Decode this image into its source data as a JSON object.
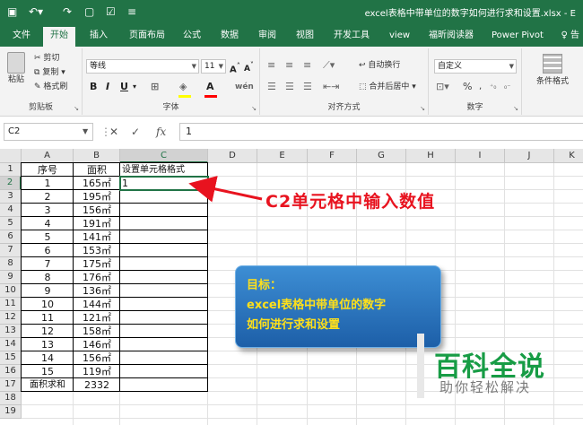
{
  "titlebar": {
    "document_title": "excel表格中带单位的数字如何进行求和设置.xlsx  -  E"
  },
  "ribbon_tabs": [
    "文件",
    "开始",
    "插入",
    "页面布局",
    "公式",
    "数据",
    "审阅",
    "视图",
    "开发工具",
    "view",
    "福昕阅读器",
    "Power Pivot"
  ],
  "active_tab": "开始",
  "ribbon": {
    "clipboard": {
      "paste": "粘贴",
      "cut": "剪切",
      "copy": "复制",
      "format_painter": "格式刷",
      "label": "剪贴板"
    },
    "font": {
      "name": "等线",
      "size": "11",
      "label": "字体"
    },
    "alignment": {
      "wrap": "自动换行",
      "merge": "合并后居中",
      "label": "对齐方式"
    },
    "number": {
      "format": "自定义",
      "label": "数字"
    },
    "styles": {
      "conditional": "条件格式"
    }
  },
  "formula_bar": {
    "name_box": "C2",
    "formula": "1"
  },
  "columns": [
    "A",
    "B",
    "C",
    "D",
    "E",
    "F",
    "G",
    "H",
    "I",
    "J",
    "K"
  ],
  "selected_column": "C",
  "rows": [
    "1",
    "2",
    "3",
    "4",
    "5",
    "6",
    "7",
    "8",
    "9",
    "10",
    "11",
    "12",
    "13",
    "14",
    "15",
    "16",
    "17",
    "18",
    "19"
  ],
  "selected_row": "2",
  "table": {
    "header": {
      "a": "序号",
      "b": "面积",
      "c": "设置单元格格式"
    },
    "data": [
      {
        "a": "1",
        "b": "165㎡",
        "c": "1"
      },
      {
        "a": "2",
        "b": "195㎡",
        "c": ""
      },
      {
        "a": "3",
        "b": "156㎡",
        "c": ""
      },
      {
        "a": "4",
        "b": "191㎡",
        "c": ""
      },
      {
        "a": "5",
        "b": "141㎡",
        "c": ""
      },
      {
        "a": "6",
        "b": "153㎡",
        "c": ""
      },
      {
        "a": "7",
        "b": "175㎡",
        "c": ""
      },
      {
        "a": "8",
        "b": "176㎡",
        "c": ""
      },
      {
        "a": "9",
        "b": "136㎡",
        "c": ""
      },
      {
        "a": "10",
        "b": "144㎡",
        "c": ""
      },
      {
        "a": "11",
        "b": "121㎡",
        "c": ""
      },
      {
        "a": "12",
        "b": "158㎡",
        "c": ""
      },
      {
        "a": "13",
        "b": "146㎡",
        "c": ""
      },
      {
        "a": "14",
        "b": "156㎡",
        "c": ""
      },
      {
        "a": "15",
        "b": "119㎡",
        "c": ""
      }
    ],
    "total": {
      "a": "面积求和",
      "b": "2332"
    }
  },
  "annotation": {
    "callout": "C2单元格中输入数值",
    "goal_lines": [
      "目标：",
      "excel表格中带单位的数字",
      "如何进行求和设置"
    ]
  },
  "watermark": {
    "main": "百科全说",
    "sub": "助你轻松解决"
  },
  "colors": {
    "excel_green": "#217346",
    "callout_red": "#e8131f",
    "goal_yellow": "#ffe01a",
    "watermark_green": "#179c45"
  }
}
